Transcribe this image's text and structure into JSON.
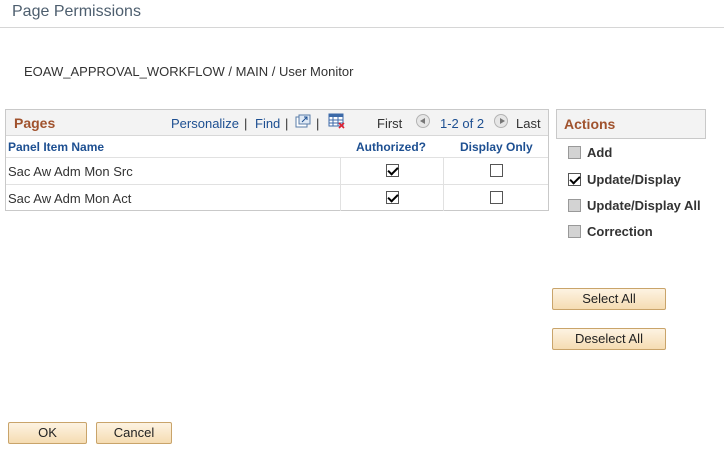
{
  "page": {
    "title": "Page Permissions",
    "breadcrumb": "EOAW_APPROVAL_WORKFLOW / MAIN / User Monitor"
  },
  "grid": {
    "title": "Pages",
    "personalize": "Personalize",
    "find": "Find",
    "separator": "|",
    "first": "First",
    "range": "1-2 of 2",
    "last": "Last",
    "columns": [
      "Panel Item Name",
      "Authorized?",
      "Display Only"
    ],
    "rows": [
      {
        "name": "Sac Aw Adm Mon Src",
        "authorized": true,
        "display_only": false
      },
      {
        "name": "Sac Aw Adm Mon Act",
        "authorized": true,
        "display_only": false
      }
    ]
  },
  "actions": {
    "title": "Actions",
    "items": [
      {
        "label": "Add",
        "checked": false
      },
      {
        "label": "Update/Display",
        "checked": true
      },
      {
        "label": "Update/Display All",
        "checked": false
      },
      {
        "label": "Correction",
        "checked": false
      }
    ]
  },
  "buttons": {
    "select_all": "Select All",
    "deselect_all": "Deselect All",
    "ok": "OK",
    "cancel": "Cancel"
  },
  "colors": {
    "accent_title": "#a0522d",
    "link": "#1d4f91",
    "button_border": "#c9a46a"
  }
}
